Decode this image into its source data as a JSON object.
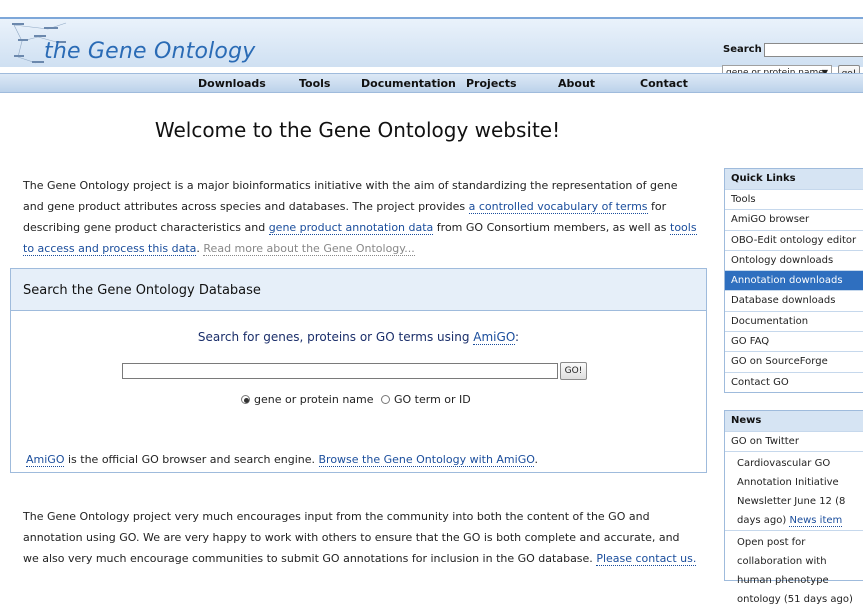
{
  "header": {
    "logo_text": "the Gene Ontology",
    "search": {
      "label": "Search",
      "input_value": "",
      "select_value": "gene or protein name",
      "go_label": "go!"
    }
  },
  "nav": {
    "items": [
      {
        "label": "Downloads"
      },
      {
        "label": "Tools"
      },
      {
        "label": "Documentation"
      },
      {
        "label": "Projects"
      },
      {
        "label": "About"
      },
      {
        "label": "Contact"
      }
    ]
  },
  "main": {
    "title": "Welcome to the Gene Ontology website!",
    "intro": {
      "text1": "The Gene Ontology project is a major bioinformatics initiative with the aim of standardizing the representation of gene and gene product attributes across species and databases. The project provides ",
      "link1": "a controlled vocabulary of terms",
      "text2": " for describing gene product characteristics and ",
      "link2": "gene product annotation data",
      "text3": " from GO Consortium members, as well as ",
      "link3": "tools to access and process this data",
      "text4": ". ",
      "link4": "Read more about the Gene Ontology..."
    },
    "db_search": {
      "title": "Search the Gene Ontology Database",
      "prompt_text": "Search for genes, proteins or GO terms using ",
      "prompt_link": "AmiGO",
      "prompt_suffix": ":",
      "input_value": "",
      "go_label": "GO!",
      "radio_gene": "gene or protein name",
      "radio_term": "GO term or ID",
      "amigo_link": "AmiGO",
      "amigo_text": " is the official GO browser and search engine. ",
      "browse_link": "Browse the Gene Ontology with AmiGO",
      "browse_suffix": "."
    },
    "outro": {
      "text": "The Gene Ontology project very much encourages input from the community into both the content of the GO and annotation using GO. We are very happy to work with others to ensure that the GO is both complete and accurate, and we also very much encourage communities to submit GO annotations for inclusion in the GO database. ",
      "link": "Please contact us."
    }
  },
  "sidebar": {
    "quick_links": {
      "title": "Quick Links",
      "items": [
        {
          "label": "Tools",
          "active": false
        },
        {
          "label": "AmiGO browser",
          "active": false
        },
        {
          "label": "OBO-Edit ontology editor",
          "active": false
        },
        {
          "label": "Ontology downloads",
          "active": false
        },
        {
          "label": "Annotation downloads",
          "active": true
        },
        {
          "label": "Database downloads",
          "active": false
        },
        {
          "label": "Documentation",
          "active": false
        },
        {
          "label": "GO FAQ",
          "active": false
        },
        {
          "label": "GO on SourceForge",
          "active": false
        },
        {
          "label": "Contact GO",
          "active": false
        }
      ]
    },
    "news": {
      "title": "News",
      "twitter": "GO on Twitter",
      "item1_text": "Cardiovascular GO Annotation Initiative Newsletter June 12 (8 days ago) ",
      "item1_link": "News item",
      "item2_text": "Open post for collaboration with human phenotype ontology (51 days ago)"
    }
  },
  "colors": {
    "accent": "#2f6fbf",
    "link": "#1a4d9c",
    "panel_bg": "#e6eff9"
  }
}
